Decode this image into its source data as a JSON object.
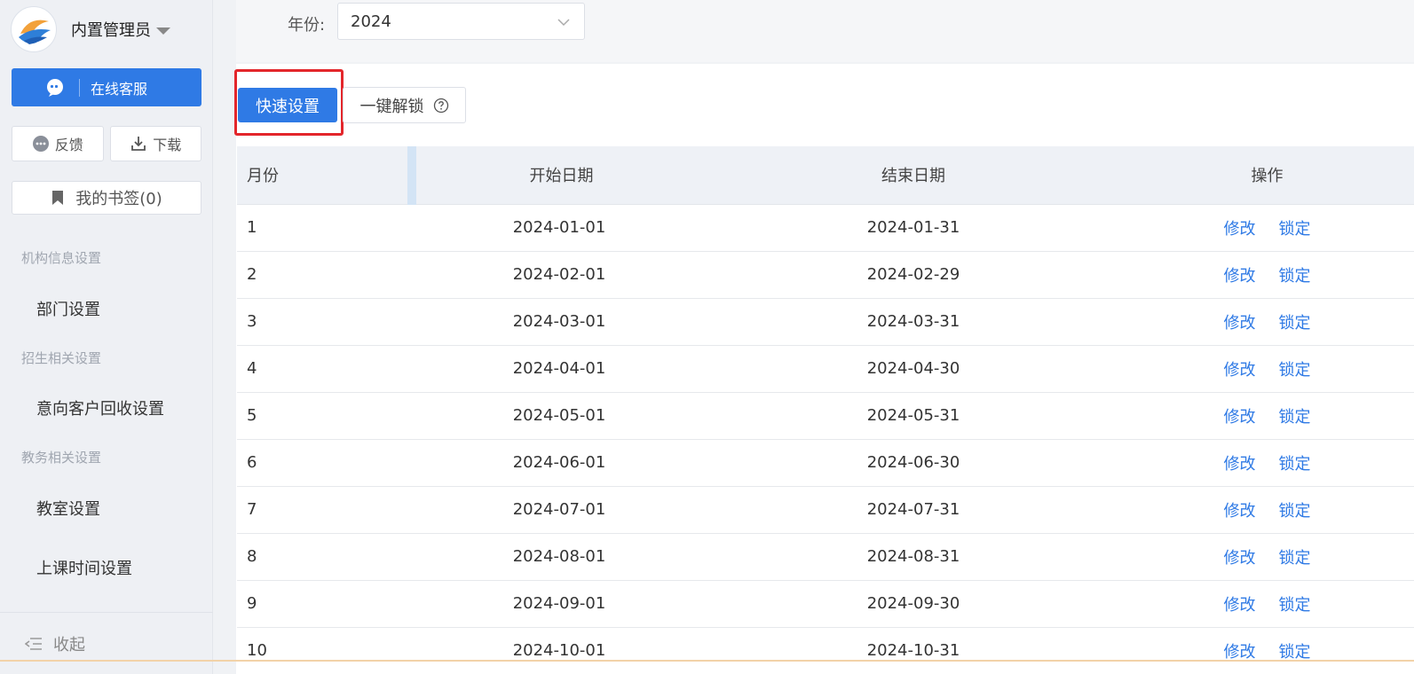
{
  "sidebar": {
    "user_name": "内置管理员",
    "service_label": "在线客服",
    "feedback_label": "反馈",
    "download_label": "下载",
    "bookmark_label": "我的书签(0)",
    "groups": [
      {
        "title": "机构信息设置",
        "items": [
          "部门设置"
        ]
      },
      {
        "title": "招生相关设置",
        "items": [
          "意向客户回收设置"
        ]
      },
      {
        "title": "教务相关设置",
        "items": [
          "教室设置",
          "上课时间设置"
        ]
      }
    ],
    "collapse_label": "收起"
  },
  "filter": {
    "year_label": "年份:",
    "year_value": "2024"
  },
  "toolbar": {
    "quick_set_label": "快速设置",
    "unlock_all_label": "一键解锁"
  },
  "table": {
    "headers": [
      "月份",
      "开始日期",
      "结束日期",
      "操作"
    ],
    "op_edit": "修改",
    "op_lock": "锁定",
    "rows": [
      {
        "month": "1",
        "start": "2024-01-01",
        "end": "2024-01-31"
      },
      {
        "month": "2",
        "start": "2024-02-01",
        "end": "2024-02-29"
      },
      {
        "month": "3",
        "start": "2024-03-01",
        "end": "2024-03-31"
      },
      {
        "month": "4",
        "start": "2024-04-01",
        "end": "2024-04-30"
      },
      {
        "month": "5",
        "start": "2024-05-01",
        "end": "2024-05-31"
      },
      {
        "month": "6",
        "start": "2024-06-01",
        "end": "2024-06-30"
      },
      {
        "month": "7",
        "start": "2024-07-01",
        "end": "2024-07-31"
      },
      {
        "month": "8",
        "start": "2024-08-01",
        "end": "2024-08-31"
      },
      {
        "month": "9",
        "start": "2024-09-01",
        "end": "2024-09-30"
      },
      {
        "month": "10",
        "start": "2024-10-01",
        "end": "2024-10-31"
      }
    ]
  },
  "colors": {
    "primary": "#2f7ae5",
    "highlight_border": "#e3262b"
  }
}
